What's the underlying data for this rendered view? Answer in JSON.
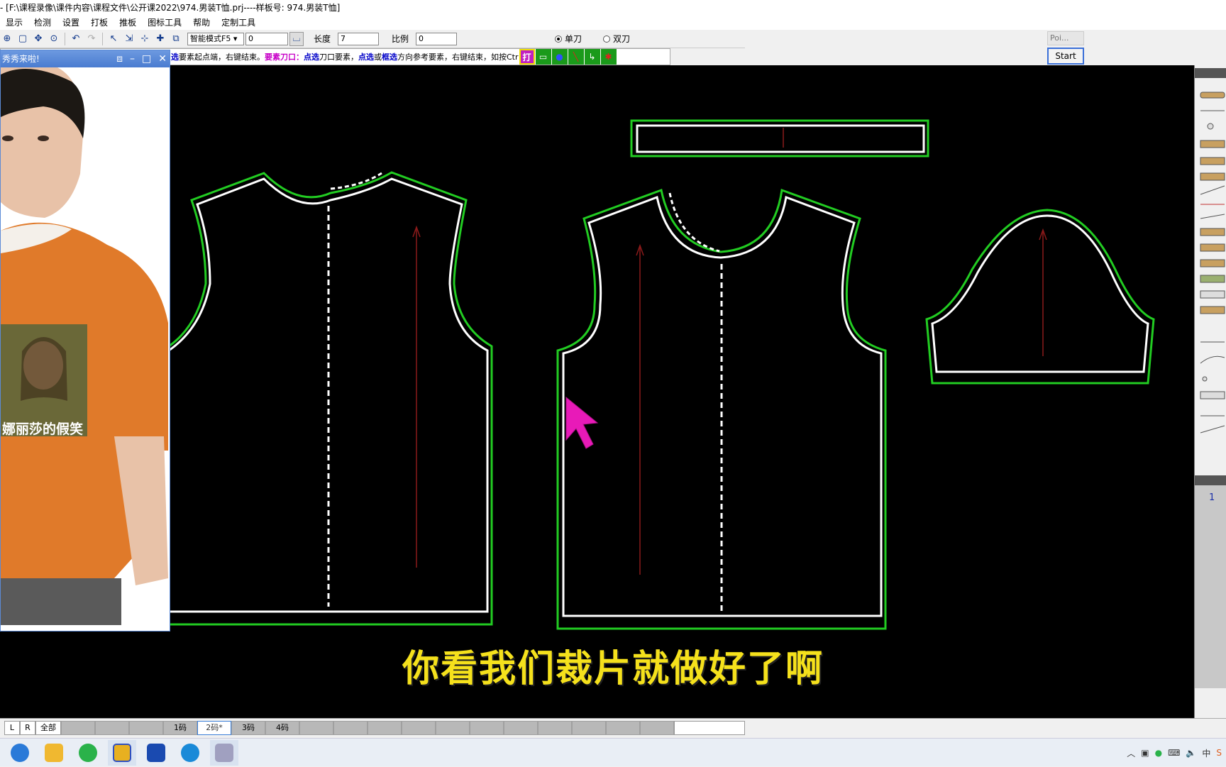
{
  "window": {
    "title": "- [F:\\课程录像\\课件内容\\课程文件\\公开课2022\\974.男装T恤.prj----样板号: 974.男装T恤]"
  },
  "menu": [
    "显示",
    "检测",
    "设置",
    "打板",
    "推板",
    "图标工具",
    "帮助",
    "定制工具"
  ],
  "toolbar": {
    "mode_select": "智能模式F5",
    "input1": "0",
    "length_label": "长度",
    "length_value": "7",
    "ratio_label": "比例",
    "ratio_value": "0",
    "radio_single": "单刀",
    "radio_double": "双刀",
    "radio_selected": "单刀"
  },
  "hint": {
    "part1": "选",
    "part2": "要素起点端，右键结束。",
    "part3": "要素刀口：",
    "part4": "点选",
    "part5": "刀口要素，",
    "part6": "点选",
    "part7": "或",
    "part8": "框选",
    "part9": "方向参考要素，右键结束，如按Ctr",
    "button1": "打"
  },
  "mini_window": {
    "title": "Poi...",
    "button": "Start"
  },
  "video_window": {
    "title": "秀秀来啦!",
    "shirt_text": "娜丽莎的假笑"
  },
  "canvas": {
    "subtitle": "你看我们裁片就做好了啊",
    "background": "#000000",
    "seam_color": "#22cc22",
    "line_color": "#ffffff",
    "grain_color": "#8b1a1a",
    "cursor_color": "#e81ab8"
  },
  "right_panel": {
    "page_number": "1"
  },
  "size_bar": {
    "buttons": [
      "L",
      "R",
      "全部"
    ],
    "sizes": [
      "1码",
      "2码*",
      "3码",
      "4码"
    ],
    "active_size": "2码*"
  }
}
